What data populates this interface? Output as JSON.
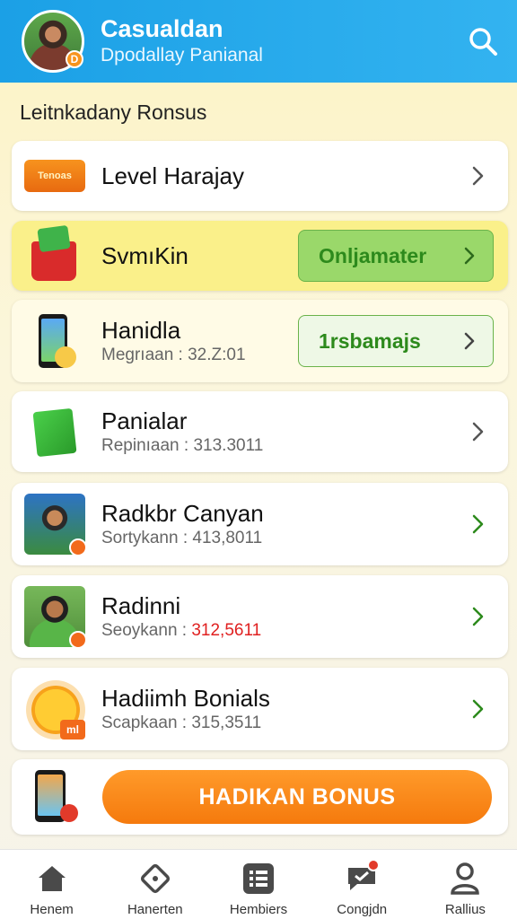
{
  "header": {
    "title": "Casualdan",
    "subtitle": "Dpodallay Panianal",
    "avatar_badge": "D"
  },
  "section": {
    "title": "Leitnkadany Ronsus"
  },
  "items": [
    {
      "title": "Level Harajay",
      "subtitle": "",
      "icon": "banner-icon",
      "icon_text": "Tenoas"
    },
    {
      "title": "SvmıKin",
      "subtitle": "",
      "icon": "basket-icon",
      "action": "Onljamater"
    },
    {
      "title": "Hanidla",
      "subtitle": "Megrıaan : 32.Z:01",
      "icon": "phone-icon",
      "action": "1rsbamajs"
    },
    {
      "title": "Panialar",
      "subtitle": "Repinıaan : 313.3011",
      "icon": "book-icon"
    },
    {
      "title": "Radkbr Canyan",
      "subtitle": "Sortykann : 413,8011",
      "icon": "photo-icon"
    },
    {
      "title": "Radinni",
      "subtitle_prefix": "Seoykann : ",
      "subtitle_value": "312,5611",
      "icon": "photo-icon"
    },
    {
      "title": "Hadiimh Bonials",
      "subtitle": "Scapkaan : 315,3511",
      "icon": "sun-icon",
      "icon_text": "ml"
    }
  ],
  "bonus_button": {
    "label": "HADIKAN BONUS"
  },
  "nav": [
    {
      "label": "Henem",
      "icon": "home-icon"
    },
    {
      "label": "Hanerten",
      "icon": "diamond-icon"
    },
    {
      "label": "Hembiers",
      "icon": "list-icon"
    },
    {
      "label": "Congjdn",
      "icon": "chat-icon"
    },
    {
      "label": "Rallius",
      "icon": "profile-icon"
    }
  ],
  "colors": {
    "header": "#1ba0e6",
    "accent_orange": "#f57a0d",
    "accent_green": "#2d8a1c",
    "highlight_yellow": "#faf08a"
  }
}
